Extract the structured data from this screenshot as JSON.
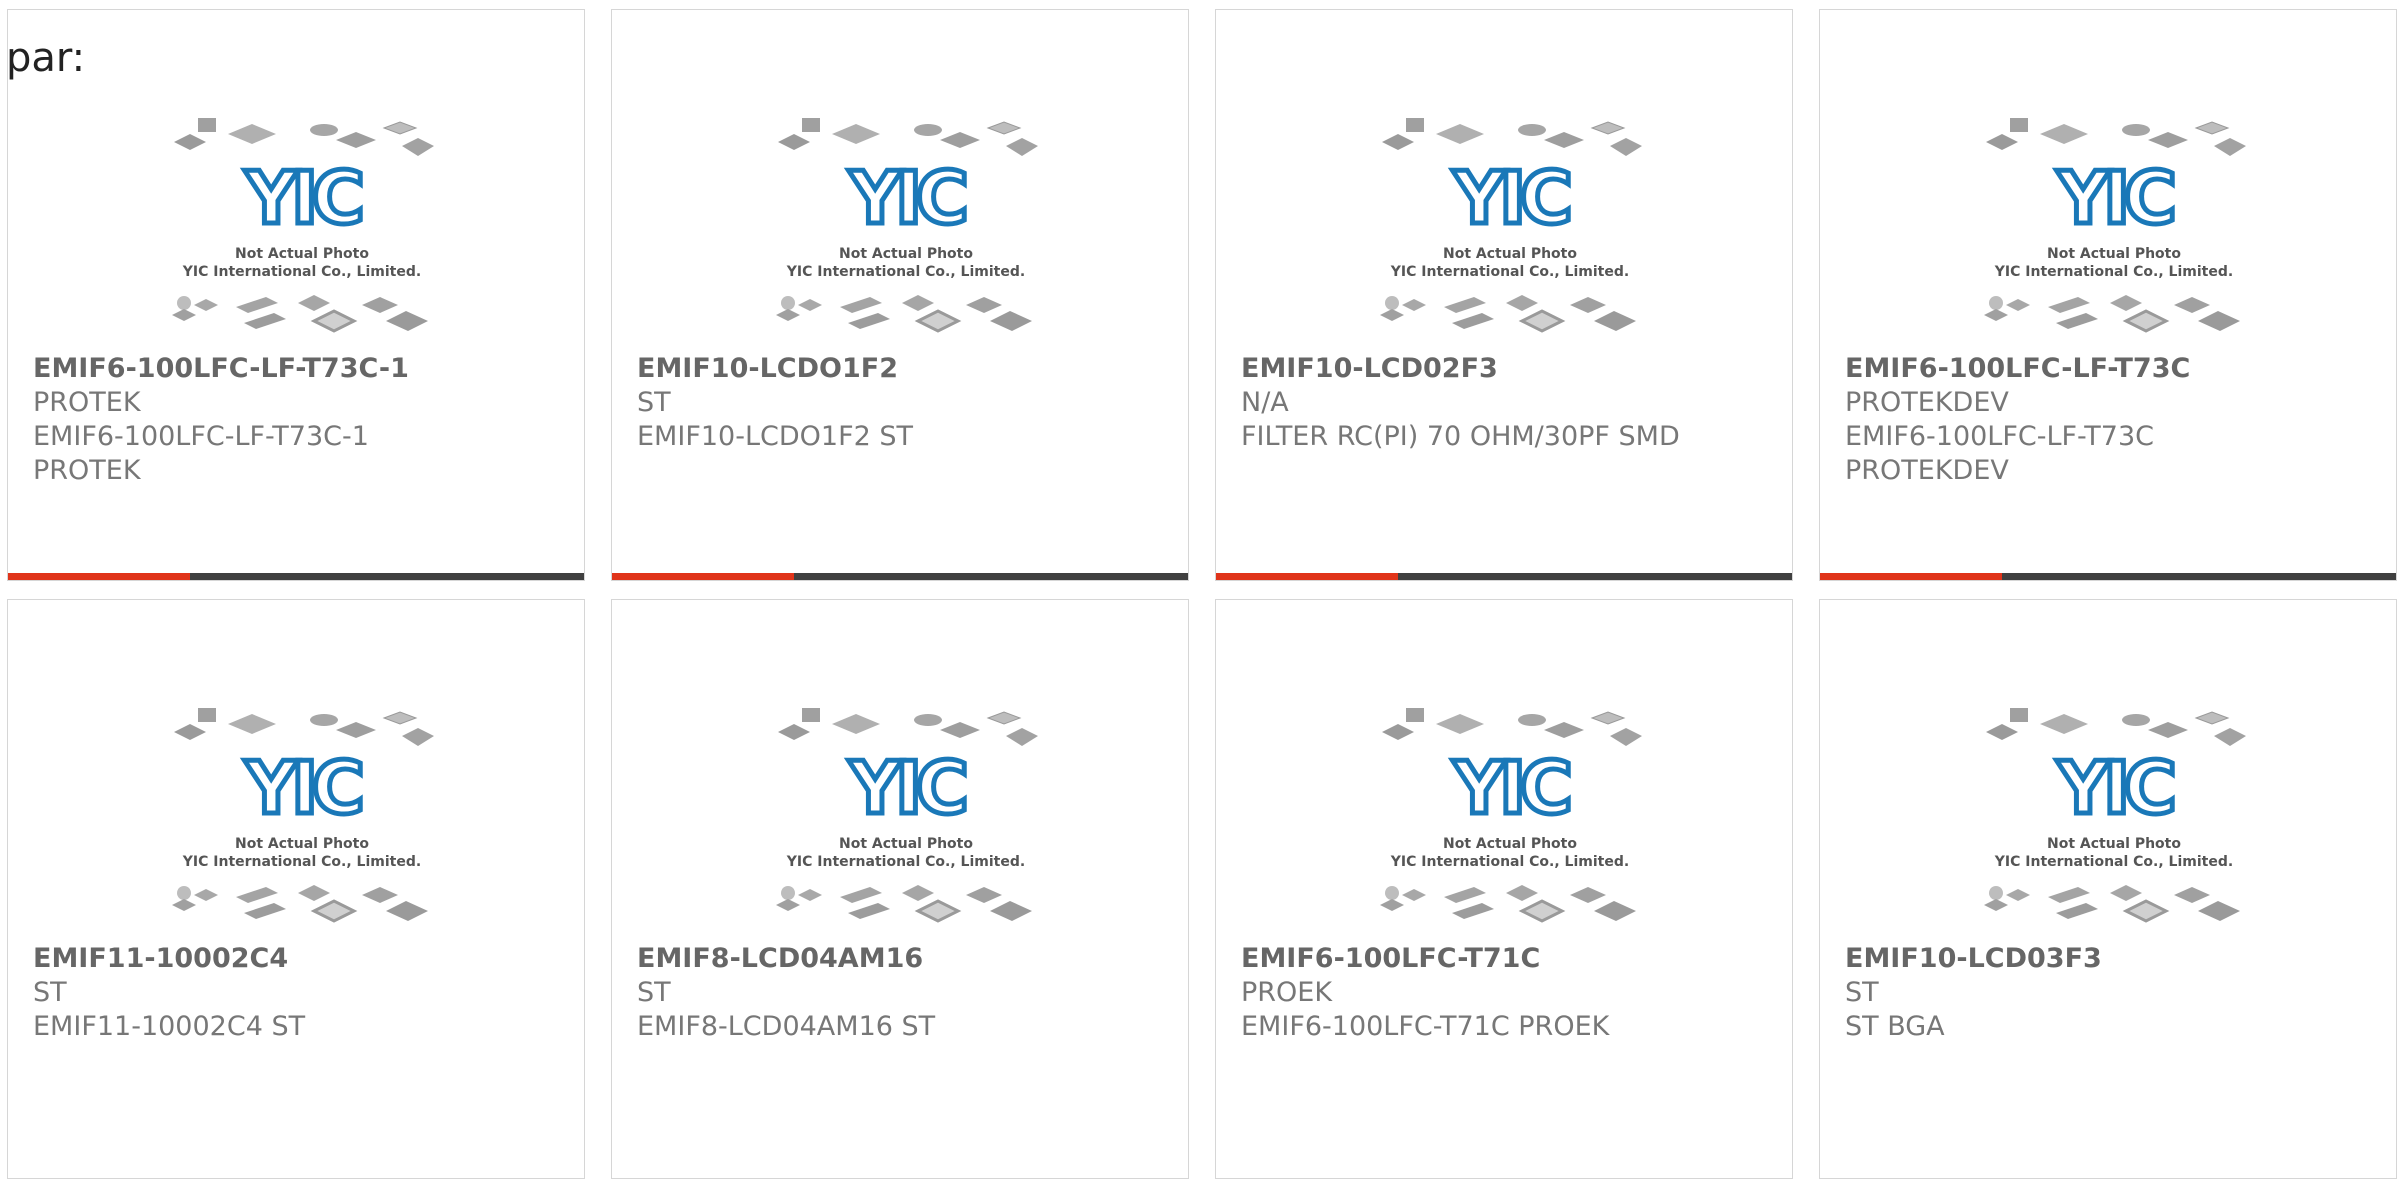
{
  "header": {
    "label": "par:"
  },
  "photo": {
    "logo_text": "YIC",
    "caption_line1": "Not Actual Photo",
    "caption_line2": "YIC International Co., Limited."
  },
  "cards": [
    {
      "part_number": "EMIF6-100LFC-LF-T73C-1",
      "lines": [
        "PROTEK",
        "EMIF6-100LFC-LF-T73C-1",
        "PROTEK"
      ]
    },
    {
      "part_number": "EMIF10-LCDO1F2",
      "lines": [
        "ST",
        "EMIF10-LCDO1F2 ST",
        ""
      ]
    },
    {
      "part_number": "EMIF10-LCD02F3",
      "lines": [
        "N/A",
        "FILTER RC(PI) 70 OHM/30PF SMD",
        ""
      ]
    },
    {
      "part_number": "EMIF6-100LFC-LF-T73C",
      "lines": [
        "PROTEKDEV",
        "EMIF6-100LFC-LF-T73C",
        "PROTEKDEV"
      ]
    },
    {
      "part_number": "EMIF11-10002C4",
      "lines": [
        "ST",
        "EMIF11-10002C4 ST",
        ""
      ]
    },
    {
      "part_number": "EMIF8-LCD04AM16",
      "lines": [
        "ST",
        "EMIF8-LCD04AM16 ST",
        ""
      ]
    },
    {
      "part_number": "EMIF6-100LFC-T71C",
      "lines": [
        "PROEK",
        "EMIF6-100LFC-T71C PROEK",
        ""
      ]
    },
    {
      "part_number": "EMIF10-LCD03F3",
      "lines": [
        "ST",
        "ST BGA",
        ""
      ]
    }
  ],
  "colors": {
    "accent": "#e0341a",
    "bar": "#404040",
    "logo": "#1a78b8"
  }
}
